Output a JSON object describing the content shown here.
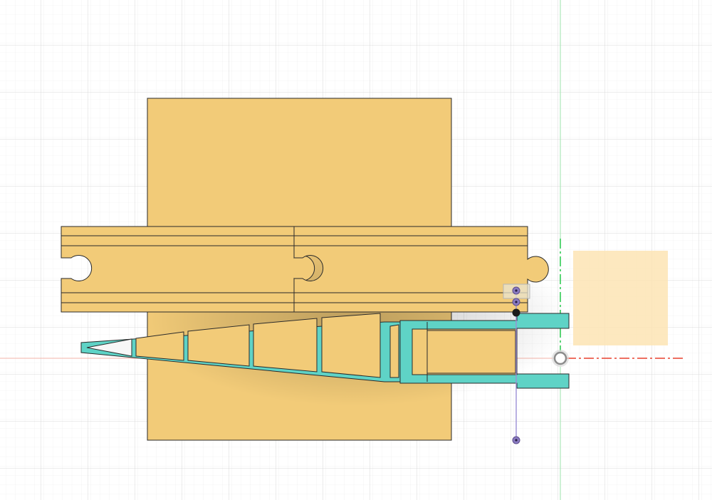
{
  "viewport": {
    "background_color": "#ffffff",
    "grid_color": "#e6e6e6",
    "axis_x_color": "#e8412f",
    "axis_y_color": "#33cc55"
  },
  "bodies": {
    "plate_color": "#f2cb78",
    "track_color": "#f2cb78",
    "arm_color": "#5fd3c6",
    "ghost_color": "#fde4b4",
    "outline_color": "#1f1f1f"
  },
  "sketch": {
    "line_color": "#9b8fd6",
    "point_color": "#6a4f9a"
  },
  "icons": {
    "origin": "origin-point-icon",
    "dimension_box": "dimension-box-icon"
  }
}
